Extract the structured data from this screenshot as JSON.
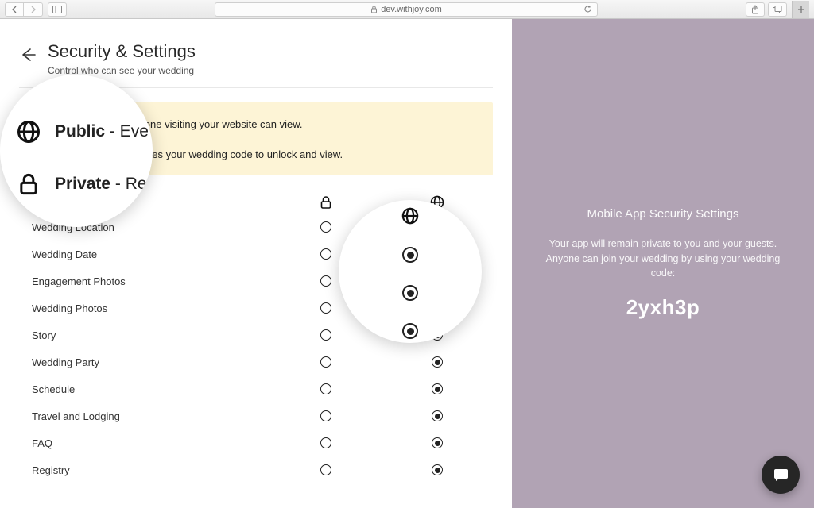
{
  "browser": {
    "url": "dev.withjoy.com"
  },
  "page": {
    "title": "Security & Settings",
    "subtitle": "Control who can see your wedding"
  },
  "notice": {
    "public": {
      "label": "Public",
      "desc": " - Everyone visiting your website can view."
    },
    "private": {
      "label": "Private",
      "desc": " - Requires your wedding code to unlock and view."
    }
  },
  "rows": [
    {
      "label": "Wedding Location",
      "public": true
    },
    {
      "label": "Wedding Date",
      "public": true
    },
    {
      "label": "Engagement Photos",
      "public": true
    },
    {
      "label": "Wedding Photos",
      "public": true
    },
    {
      "label": "Story",
      "public": true
    },
    {
      "label": "Wedding Party",
      "public": true
    },
    {
      "label": "Schedule",
      "public": true
    },
    {
      "label": "Travel and Lodging",
      "public": true
    },
    {
      "label": "FAQ",
      "public": true
    },
    {
      "label": "Registry",
      "public": true
    }
  ],
  "mobile": {
    "title": "Mobile App Security Settings",
    "body1": "Your app will remain private to you and your guests.",
    "body2": "Anyone can join your wedding by using your wedding code:",
    "code": "2yxh3p"
  }
}
